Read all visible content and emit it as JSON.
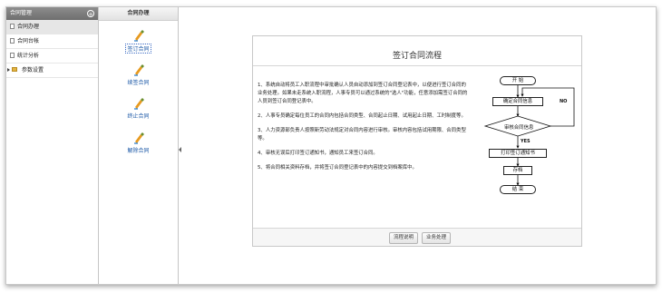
{
  "sidebar": {
    "title": "合同管理",
    "items": [
      {
        "label": "合同办理",
        "icon": "document-icon",
        "active": true
      },
      {
        "label": "合同台帐",
        "icon": "document-icon",
        "active": false
      },
      {
        "label": "统计分析",
        "icon": "document-icon",
        "active": false
      },
      {
        "label": "参数设置",
        "icon": "folder-icon",
        "active": false
      }
    ]
  },
  "midpanel": {
    "title": "合同办理",
    "items": [
      {
        "label": "签订合同",
        "icon": "pen-icon",
        "selected": true
      },
      {
        "label": "续签合同",
        "icon": "pen-icon",
        "selected": false
      },
      {
        "label": "终止合同",
        "icon": "pen-icon",
        "selected": false
      },
      {
        "label": "解除合同",
        "icon": "pen-icon",
        "selected": false
      }
    ]
  },
  "card": {
    "title": "签订合同流程",
    "steps": [
      "1、系统自动将员工入职流程中审批确认人员自动添加到签订合同登记表中，以便进行签订合同的业务处理。如果未走系统入职流程，人事专员可以通过系统的\"选人\"功能，任意添加需签订合同的人员到签订合同登记表中。",
      "2、人事专员确定每位员工的合同内包括合同类型、合同起止日期、试用起止日期、工时制度等。",
      "3、人力资源部负责人按照新劳动法规定对合同内容进行审核。审核内容包括试用期限、合同类型等。",
      "4、审核无误后打印签订通知书，通知员工来签订合同。",
      "5、将合同相关资料存档，并将签订合同登记表中的内容提交到档案库中。"
    ],
    "footer_buttons": [
      "流程说明",
      "业务处理"
    ]
  },
  "flowchart": {
    "start": "开 始",
    "confirm": "确定合同信息",
    "review": "审核合同信息",
    "yes": "YES",
    "no": "NO",
    "print": "打印签订通知书",
    "archive": "存档",
    "end": "结 束"
  }
}
